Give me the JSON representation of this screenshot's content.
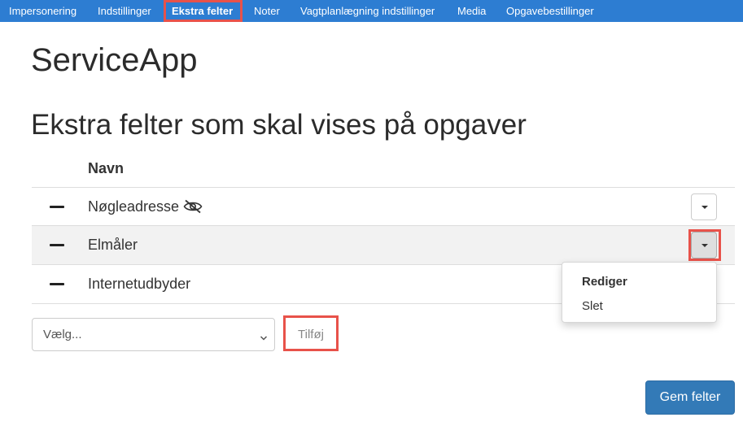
{
  "nav": {
    "items": [
      {
        "label": "Impersonering"
      },
      {
        "label": "Indstillinger"
      },
      {
        "label": "Ekstra felter",
        "active": true
      },
      {
        "label": "Noter"
      },
      {
        "label": "Vagtplanlægning indstillinger"
      },
      {
        "label": "Media"
      },
      {
        "label": "Opgavebestillinger"
      }
    ],
    "background_color": "#2d7dd2"
  },
  "app_title": "ServiceApp",
  "page_heading": "Ekstra felter som skal vises på opgaver",
  "table": {
    "column_header": "Navn",
    "rows": [
      {
        "name": "Nøgleadresse",
        "hidden_icon": "eye-slash-icon"
      },
      {
        "name": "Elmåler"
      },
      {
        "name": "Internetudbyder"
      }
    ]
  },
  "dropdown_menu": {
    "items": [
      {
        "label": "Rediger"
      },
      {
        "label": "Slet"
      }
    ]
  },
  "add_form": {
    "select_value": "Vælg...",
    "add_label": "Tilføj"
  },
  "save_label": "Gem felter",
  "highlight_color": "#e8524a",
  "primary_color": "#337ab7"
}
